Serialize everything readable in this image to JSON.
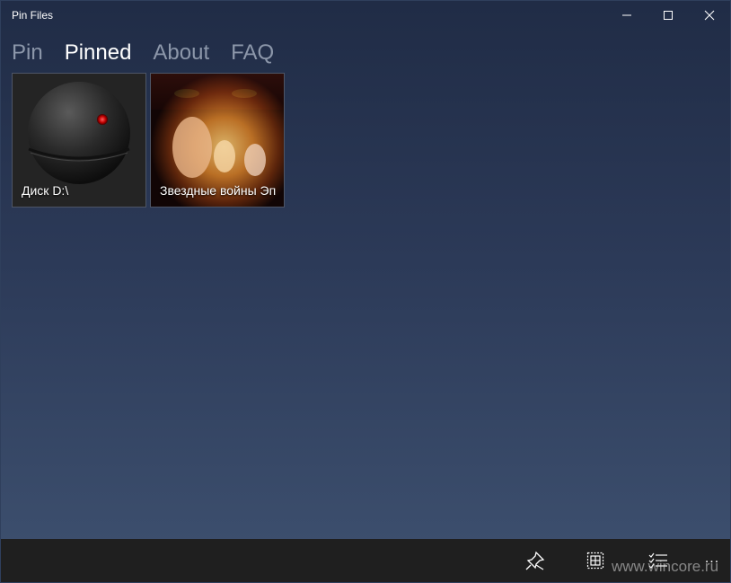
{
  "window": {
    "title": "Pin Files"
  },
  "tabs": [
    {
      "label": "Pin",
      "active": false
    },
    {
      "label": "Pinned",
      "active": true
    },
    {
      "label": "About",
      "active": false
    },
    {
      "label": "FAQ",
      "active": false
    }
  ],
  "tiles": [
    {
      "label": "Диск D:\\",
      "icon": "drive-sphere-icon"
    },
    {
      "label": "Звездные войны Эп",
      "icon": "movie-poster-thumbnail"
    }
  ],
  "bottombar": {
    "icons": [
      "unpin-icon",
      "select-all-icon",
      "multi-select-icon",
      "more-icon"
    ],
    "more_glyph": "..."
  },
  "watermark": "www.wincore.ru",
  "colors": {
    "accent_text": "#ffffff",
    "inactive_tab": "#8c97aa",
    "bottombar_bg": "#1f1f1f"
  }
}
